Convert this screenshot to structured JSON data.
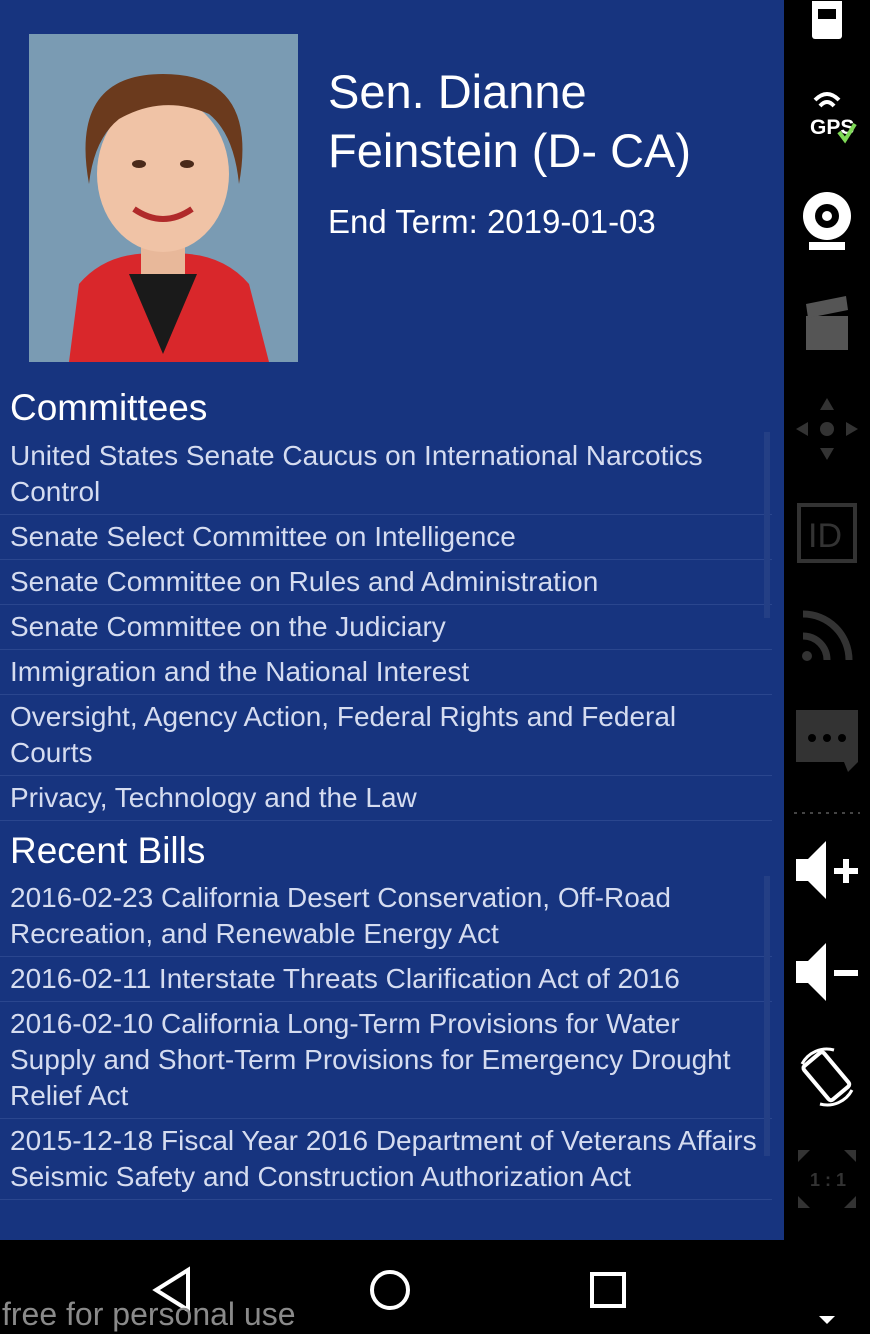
{
  "senator": {
    "name": "Sen. Dianne Feinstein (D- CA)",
    "end_term": "End Term: 2019-01-03"
  },
  "committees": {
    "title": "Committees",
    "items": [
      "United States Senate Caucus on International Narcotics Control",
      "Senate Select Committee on Intelligence",
      "Senate Committee on Rules and Administration",
      "Senate Committee on the Judiciary",
      "Immigration and the National Interest",
      "Oversight, Agency Action, Federal Rights and Federal Courts",
      "Privacy, Technology and the Law"
    ]
  },
  "bills": {
    "title": "Recent Bills",
    "items": [
      "2016-02-23 California Desert Conservation, Off-Road Recreation, and Renewable Energy Act",
      "2016-02-11 Interstate Threats Clarification Act of 2016",
      "2016-02-10 California Long-Term Provisions for Water Supply and Short-Term Provisions for Emergency Drought Relief Act",
      "2015-12-18 Fiscal Year 2016 Department of Veterans Affairs Seismic Safety and Construction Authorization Act"
    ]
  },
  "side_panel": {
    "gps_label": "GPS",
    "id_label": "ID",
    "ratio_label": "1 : 1",
    "icons": [
      "battery-icon",
      "gps-icon",
      "webcam-icon",
      "clapperboard-icon",
      "dpad-icon",
      "id-icon",
      "rss-icon",
      "message-icon",
      "volume-up-icon",
      "volume-down-icon",
      "rotate-icon",
      "scale-icon",
      "chevron-down-icon"
    ]
  },
  "watermark": "free for personal use",
  "colors": {
    "app_background": "#17347f",
    "text": "#ffffff",
    "list_text": "#d5dcf0",
    "photo_jacket": "#d9272b"
  }
}
